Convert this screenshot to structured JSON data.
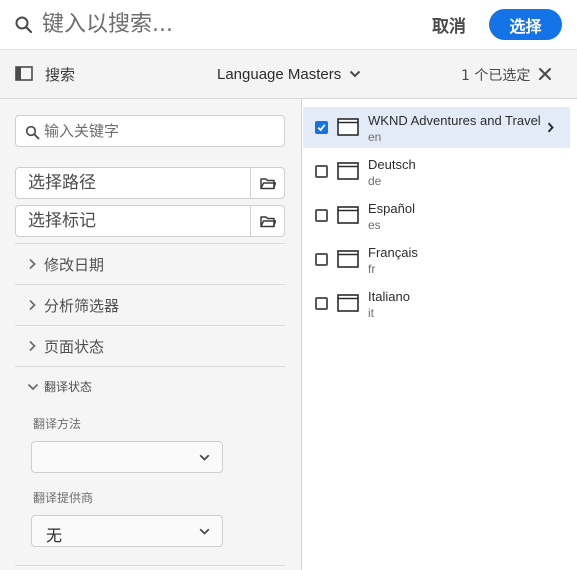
{
  "search": {
    "placeholder": "键入以搜索...",
    "cancel_label": "取消",
    "select_label": "选择"
  },
  "toolbar": {
    "rail_label": "搜索",
    "source_label": "Language Masters",
    "selected_count": "1 个已选定"
  },
  "filters": {
    "keyword_placeholder": "输入关键字",
    "path_placeholder": "选择路径",
    "tags_placeholder": "选择标记",
    "sections": [
      {
        "label": "修改日期",
        "expanded": false
      },
      {
        "label": "分析筛选器",
        "expanded": false
      },
      {
        "label": "页面状态",
        "expanded": false
      },
      {
        "label": "翻译状态",
        "expanded": true
      }
    ],
    "translation_method_label": "翻译方法",
    "translation_method_value": "",
    "translation_provider_label": "翻译提供商",
    "translation_provider_value": "无"
  },
  "results": [
    {
      "title": "WKND Adventures and Travel",
      "subtitle": "en",
      "selected": true,
      "has_children": true
    },
    {
      "title": "Deutsch",
      "subtitle": "de",
      "selected": false,
      "has_children": false
    },
    {
      "title": "Español",
      "subtitle": "es",
      "selected": false,
      "has_children": false
    },
    {
      "title": "Français",
      "subtitle": "fr",
      "selected": false,
      "has_children": false
    },
    {
      "title": "Italiano",
      "subtitle": "it",
      "selected": false,
      "has_children": false
    }
  ],
  "colors": {
    "accent": "#1473e6",
    "selected_row": "#e2ebf7",
    "rail_background": "#f5f5f5",
    "toolbar_background": "#f4f4f4"
  },
  "icons": {
    "search": "search-icon",
    "rail_toggle": "rail-toggle-icon",
    "dropdown": "chevron-down-icon",
    "clear": "close-icon",
    "browse": "folder-icon",
    "collapsed_section": "chevron-right-icon",
    "page": "page-icon",
    "checkbox": "checkmark-icon"
  }
}
